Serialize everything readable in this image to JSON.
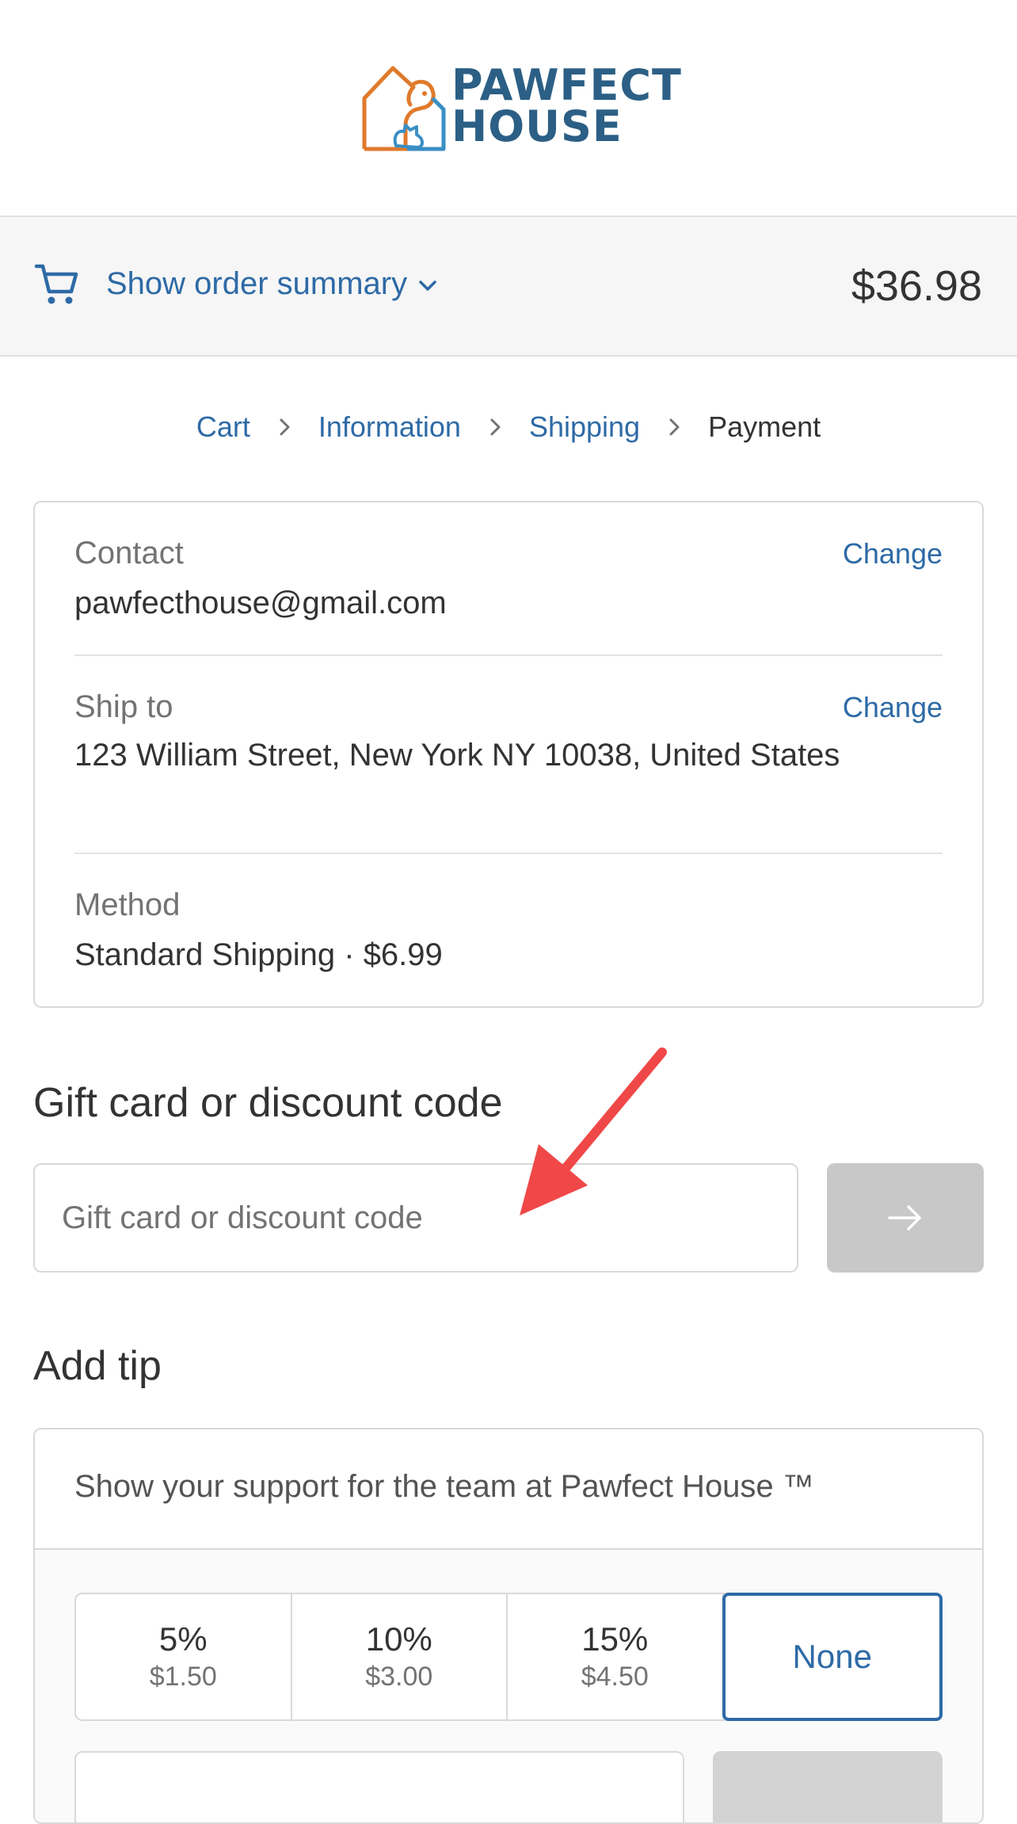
{
  "brand": {
    "line1": "PAWFECT",
    "line2": "HOUSE",
    "colors": {
      "orange": "#e07a2c",
      "blue": "#3a8fc4",
      "text": "#2c5f85"
    }
  },
  "summary": {
    "toggle_label": "Show order summary",
    "total": "$36.98",
    "icons": [
      "cart-icon",
      "chevron-down-icon"
    ]
  },
  "breadcrumb": {
    "items": [
      "Cart",
      "Information",
      "Shipping",
      "Payment"
    ],
    "current": "Payment"
  },
  "review": {
    "contact": {
      "label": "Contact",
      "value": "pawfecthouse@gmail.com",
      "link": "Change"
    },
    "ship_to": {
      "label": "Ship to",
      "value": "123 William Street, New York NY 10038, United States",
      "link": "Change"
    },
    "method": {
      "label": "Method",
      "value_prefix": "Standard Shipping · ",
      "value_price": "$6.99"
    }
  },
  "discount": {
    "title": "Gift card or discount code",
    "placeholder": "Gift card or discount code",
    "value": ""
  },
  "tip": {
    "title": "Add tip",
    "message": "Show your support for the team at Pawfect House ™",
    "options": [
      {
        "percent": "5%",
        "amount": "$1.50"
      },
      {
        "percent": "10%",
        "amount": "$3.00"
      },
      {
        "percent": "15%",
        "amount": "$4.50"
      },
      {
        "percent": "None",
        "amount": ""
      }
    ],
    "selected": "None"
  },
  "colors": {
    "link": "#2e6aa6",
    "annotation_arrow": "#f04848",
    "button_disabled": "#c8c8c8"
  }
}
